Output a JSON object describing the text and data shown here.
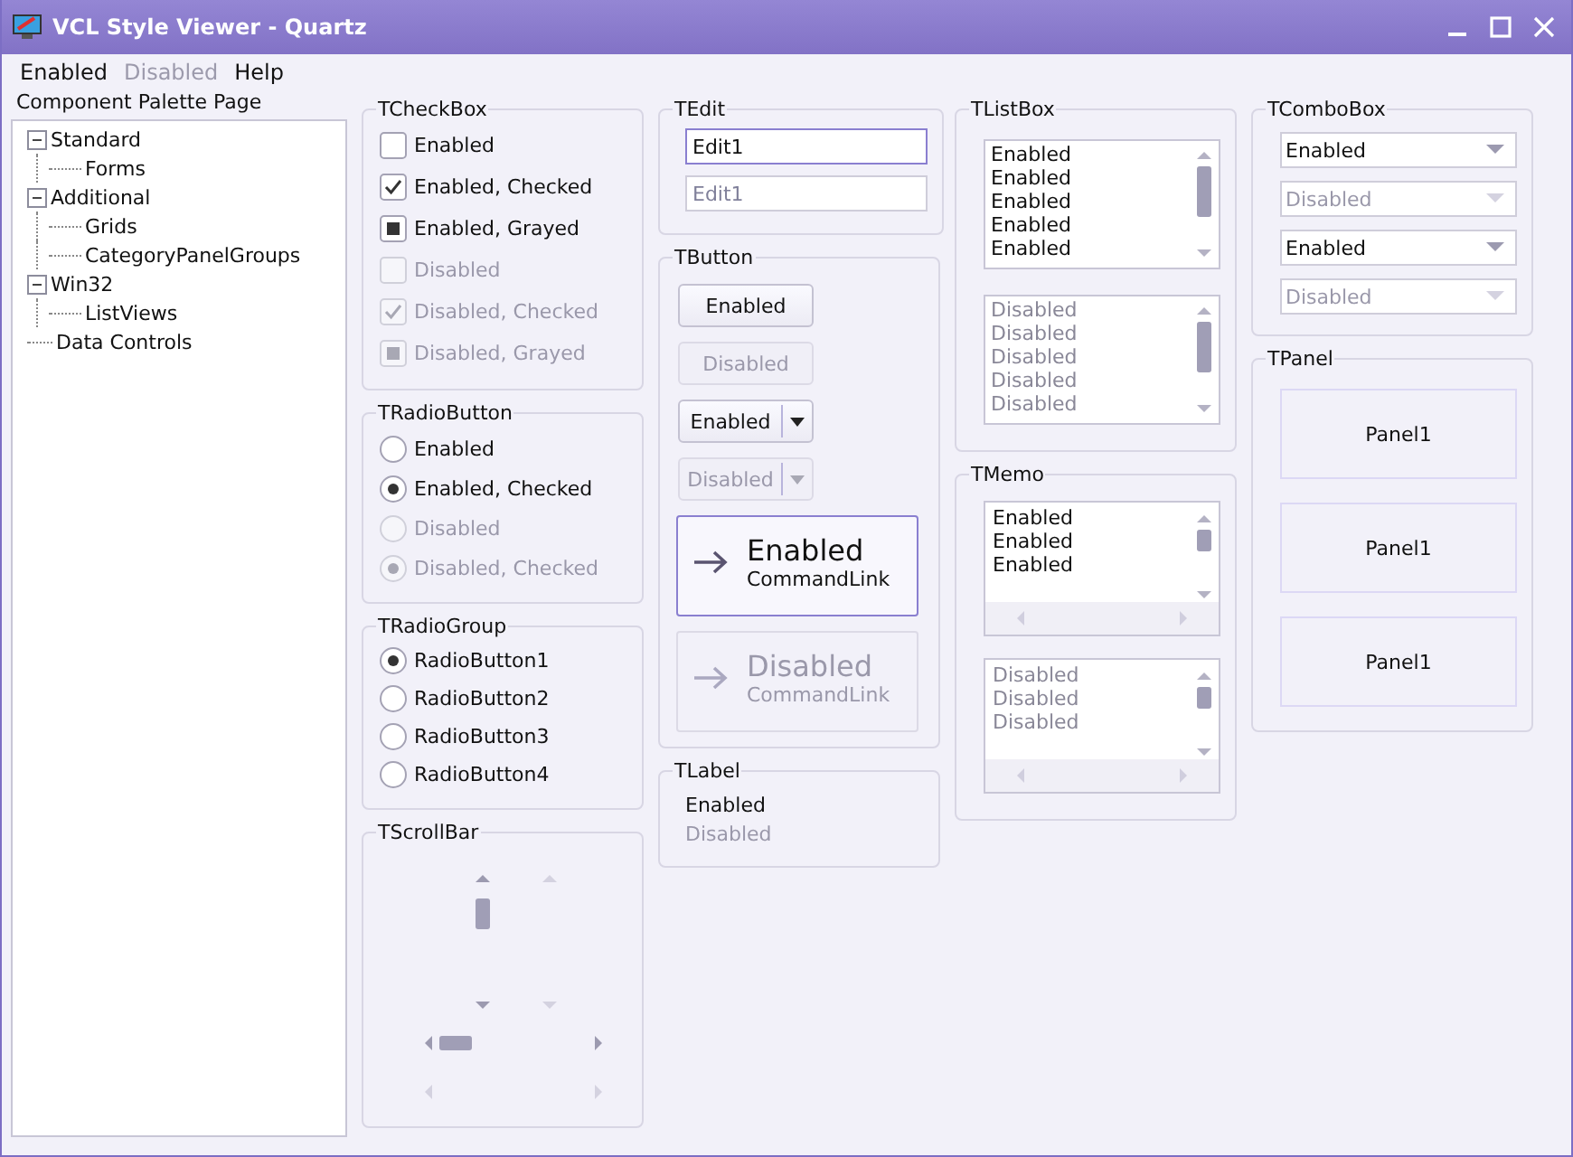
{
  "window": {
    "title": "VCL Style Viewer - Quartz"
  },
  "menu": [
    {
      "label": "Enabled",
      "disabled": false
    },
    {
      "label": "Disabled",
      "disabled": true
    },
    {
      "label": "Help",
      "disabled": false
    }
  ],
  "palette_label": "Component Palette Page",
  "tree": [
    {
      "label": "Standard",
      "expanded": true,
      "children": [
        {
          "label": "Forms"
        }
      ]
    },
    {
      "label": "Additional",
      "expanded": true,
      "children": [
        {
          "label": "Grids"
        },
        {
          "label": "CategoryPanelGroups"
        }
      ]
    },
    {
      "label": "Win32",
      "expanded": true,
      "children": [
        {
          "label": "ListViews"
        }
      ]
    },
    {
      "label": "Data Controls"
    }
  ],
  "checkboxes": {
    "title": "TCheckBox",
    "items": [
      {
        "label": "Enabled",
        "checked": false,
        "grayed": false,
        "disabled": false
      },
      {
        "label": "Enabled, Checked",
        "checked": true,
        "grayed": false,
        "disabled": false
      },
      {
        "label": "Enabled, Grayed",
        "checked": false,
        "grayed": true,
        "disabled": false
      },
      {
        "label": "Disabled",
        "checked": false,
        "grayed": false,
        "disabled": true
      },
      {
        "label": "Disabled, Checked",
        "checked": true,
        "grayed": false,
        "disabled": true
      },
      {
        "label": "Disabled, Grayed",
        "checked": false,
        "grayed": true,
        "disabled": true
      }
    ]
  },
  "radio_buttons": {
    "title": "TRadioButton",
    "items": [
      {
        "label": "Enabled",
        "selected": false,
        "disabled": false
      },
      {
        "label": "Enabled, Checked",
        "selected": true,
        "disabled": false
      },
      {
        "label": "Disabled",
        "selected": false,
        "disabled": true
      },
      {
        "label": "Disabled, Checked",
        "selected": true,
        "disabled": true
      }
    ]
  },
  "radio_group": {
    "title": "TRadioGroup",
    "items": [
      {
        "label": "RadioButton1",
        "selected": true
      },
      {
        "label": "RadioButton2",
        "selected": false
      },
      {
        "label": "RadioButton3",
        "selected": false
      },
      {
        "label": "RadioButton4",
        "selected": false
      }
    ]
  },
  "scroll_bars": {
    "title": "TScrollBar",
    "items": [
      {
        "kind": "vertical",
        "disabled": false
      },
      {
        "kind": "vertical",
        "disabled": true
      },
      {
        "kind": "horizontal",
        "disabled": false
      },
      {
        "kind": "horizontal",
        "disabled": true
      }
    ]
  },
  "edits": {
    "title": "TEdit",
    "items": [
      {
        "value": "Edit1",
        "disabled": false
      },
      {
        "value": "Edit1",
        "disabled": true
      }
    ]
  },
  "buttons": {
    "title": "TButton",
    "items": [
      {
        "kind": "push",
        "label": "Enabled",
        "disabled": false
      },
      {
        "kind": "push",
        "label": "Disabled",
        "disabled": true
      },
      {
        "kind": "split",
        "label": "Enabled",
        "disabled": false
      },
      {
        "kind": "split",
        "label": "Disabled",
        "disabled": true
      },
      {
        "kind": "command_link",
        "label": "Enabled",
        "note": "CommandLink",
        "disabled": false
      },
      {
        "kind": "command_link",
        "label": "Disabled",
        "note": "CommandLink",
        "disabled": true
      }
    ]
  },
  "labels": {
    "title": "TLabel",
    "items": [
      {
        "text": "Enabled",
        "disabled": false
      },
      {
        "text": "Disabled",
        "disabled": true
      }
    ]
  },
  "list_boxes": {
    "title": "TListBox",
    "items": [
      {
        "disabled": false,
        "lines": [
          "Enabled",
          "Enabled",
          "Enabled",
          "Enabled",
          "Enabled"
        ]
      },
      {
        "disabled": true,
        "lines": [
          "Disabled",
          "Disabled",
          "Disabled",
          "Disabled",
          "Disabled"
        ]
      }
    ]
  },
  "memos": {
    "title": "TMemo",
    "items": [
      {
        "disabled": false,
        "lines": [
          "Enabled",
          "Enabled",
          "Enabled"
        ]
      },
      {
        "disabled": true,
        "lines": [
          "Disabled",
          "Disabled",
          "Disabled"
        ]
      }
    ]
  },
  "combo_boxes": {
    "title": "TComboBox",
    "items": [
      {
        "value": "Enabled",
        "disabled": false
      },
      {
        "value": "Disabled",
        "disabled": true
      },
      {
        "value": "Enabled",
        "disabled": false
      },
      {
        "value": "Disabled",
        "disabled": true
      }
    ]
  },
  "panels": {
    "title": "TPanel",
    "items": [
      "Panel1",
      "Panel1",
      "Panel1"
    ]
  }
}
